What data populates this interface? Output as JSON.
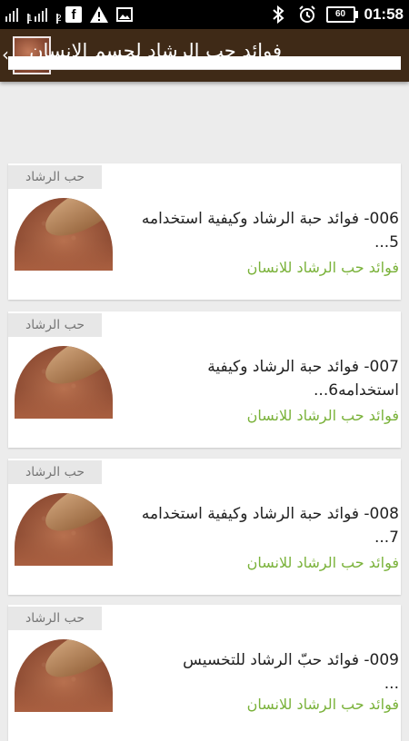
{
  "status_bar": {
    "sim1": "1",
    "sim2": "2",
    "battery": "60",
    "time": "01:58",
    "icons": [
      "signal-icon",
      "signal-icon",
      "facebook-icon",
      "warning-icon",
      "image-icon",
      "bluetooth-icon",
      "alarm-icon",
      "battery-icon"
    ]
  },
  "app_bar": {
    "title": "فوائد حب الرشاد لجسم الانسان",
    "back_icon": "chevron-left-icon"
  },
  "items": [
    {
      "tag": "حب الرشاد",
      "title_line1": "006- فوائد حبة الرشاد وكيفية استخدامه",
      "title_line2": "5...",
      "subtitle": "فوائد حب الرشاد للانسان"
    },
    {
      "tag": "حب الرشاد",
      "title_line1": "007- فوائد حبة الرشاد وكيفية",
      "title_line2": "استخدامه6...",
      "subtitle": "فوائد حب الرشاد للانسان"
    },
    {
      "tag": "حب الرشاد",
      "title_line1": "008- فوائد حبة الرشاد وكيفية استخدامه",
      "title_line2": "7...",
      "subtitle": "فوائد حب الرشاد للانسان"
    },
    {
      "tag": "حب الرشاد",
      "title_line1": "009- فوائد حبّ الرشاد للتخسيس",
      "title_line2": "...",
      "subtitle": "فوائد حب الرشاد للانسان"
    }
  ]
}
